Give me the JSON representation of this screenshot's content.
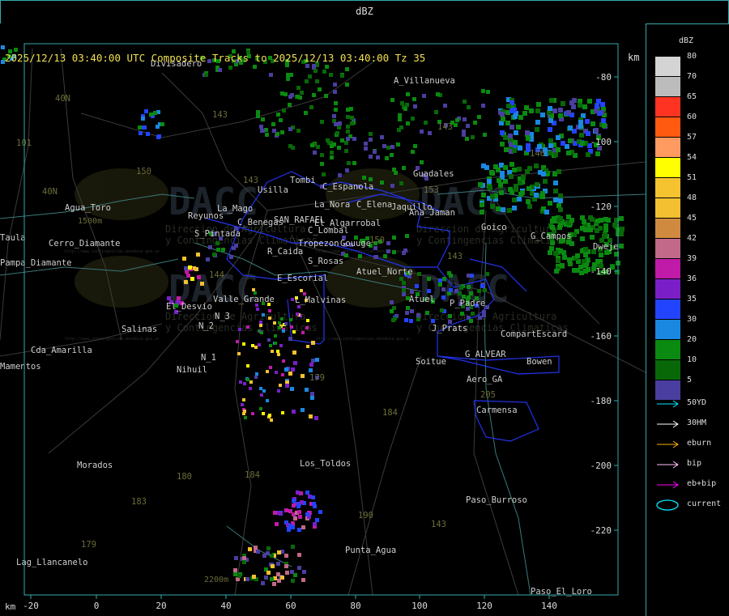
{
  "window": {
    "title": "dBZ"
  },
  "header": {
    "text": "2025/12/13 03:40:00 UTC Composite Tracks to 2025/12/13 03:40:00 Tz 35",
    "km_label": "km"
  },
  "axes": {
    "x_label": "km",
    "x_ticks": [
      "-20",
      "0",
      "20",
      "40",
      "60",
      "80",
      "100",
      "120",
      "140"
    ],
    "y_ticks": [
      "-80",
      "-100",
      "-120",
      "-140",
      "-160",
      "-180",
      "-200",
      "-220"
    ]
  },
  "legend": {
    "title": "dBZ",
    "bins": [
      {
        "label": "80",
        "color": "#d4d4d4"
      },
      {
        "label": "70",
        "color": "#bcbcbc"
      },
      {
        "label": "65",
        "color": "#ff3322"
      },
      {
        "label": "60",
        "color": "#ff5a10"
      },
      {
        "label": "57",
        "color": "#ff9a60"
      },
      {
        "label": "54",
        "color": "#ffff00"
      },
      {
        "label": "51",
        "color": "#f5c230"
      },
      {
        "label": "48",
        "color": "#f2c030"
      },
      {
        "label": "45",
        "color": "#d08a40"
      },
      {
        "label": "42",
        "color": "#c26888"
      },
      {
        "label": "39",
        "color": "#c01aa8"
      },
      {
        "label": "36",
        "color": "#7a1fc8"
      },
      {
        "label": "35",
        "color": "#2244ff"
      },
      {
        "label": "30",
        "color": "#1a88e0"
      },
      {
        "label": "20",
        "color": "#0a8a10"
      },
      {
        "label": "10",
        "color": "#086808"
      },
      {
        "label": "5",
        "color": "#4a3ea0"
      }
    ],
    "tracks": [
      {
        "label": "50YD",
        "color": "#00e8ff"
      },
      {
        "label": "30HM",
        "color": "#ffffff"
      },
      {
        "label": "eburn",
        "color": "#ffb000"
      },
      {
        "label": "bip",
        "color": "#ffc0ff"
      },
      {
        "label": "eb+bip",
        "color": "#ff00ff"
      }
    ],
    "current": {
      "label": "current",
      "color": "#00e8ff"
    }
  },
  "places": [
    {
      "name": "Divisadero"
    },
    {
      "name": "A_Villanueva"
    },
    {
      "name": "Guadales"
    },
    {
      "name": "Usilla"
    },
    {
      "name": "Tombi"
    },
    {
      "name": "C_Espanola"
    },
    {
      "name": "La_Nora"
    },
    {
      "name": "C_Elena"
    },
    {
      "name": "Jaquillo"
    },
    {
      "name": "Ana_Jaman"
    },
    {
      "name": "Goico"
    },
    {
      "name": "G_Campos"
    },
    {
      "name": "Dweje"
    },
    {
      "name": "Agua_Toro"
    },
    {
      "name": "Bowen"
    },
    {
      "name": "Reyunos"
    },
    {
      "name": "La_Mago"
    },
    {
      "name": "C_Benegas"
    },
    {
      "name": "SAN_RAFAEL"
    },
    {
      "name": "El_Algarrobal"
    },
    {
      "name": "C_Lombal"
    },
    {
      "name": "S_Pintada"
    },
    {
      "name": "Pampa_Diamante"
    },
    {
      "name": "Cerro_Diamante"
    },
    {
      "name": "Taula"
    },
    {
      "name": "R_Caida"
    },
    {
      "name": "Tropezon"
    },
    {
      "name": "Gouuge"
    },
    {
      "name": "S_Rosas"
    },
    {
      "name": "Atuel_Norte"
    },
    {
      "name": "E_Escorial"
    },
    {
      "name": "El_Desvio"
    },
    {
      "name": "Valle_Grande"
    },
    {
      "name": "L_Malvinas"
    },
    {
      "name": "Atuel"
    },
    {
      "name": "P_Padre"
    },
    {
      "name": "Salinas"
    },
    {
      "name": "N_3"
    },
    {
      "name": "N_2"
    },
    {
      "name": "N_1"
    },
    {
      "name": "J_Prats"
    },
    {
      "name": "CompartEscard"
    },
    {
      "name": "Cda_Amarilla"
    },
    {
      "name": "Mamentos"
    },
    {
      "name": "Nihuil"
    },
    {
      "name": "G_ALVEAR"
    },
    {
      "name": "Soitue"
    },
    {
      "name": "Aero_GA"
    },
    {
      "name": "Carmensa"
    },
    {
      "name": "Morados"
    },
    {
      "name": "Los_Toldos"
    },
    {
      "name": "Paso_Burroso"
    },
    {
      "name": "Punta_Agua"
    },
    {
      "name": "Lag_Llancanelo"
    },
    {
      "name": "Paso_El_Loro"
    }
  ],
  "route_labels": [
    "40N",
    "40N",
    "101",
    "143",
    "143",
    "150",
    "150",
    "153",
    "143",
    "146",
    "144",
    "143",
    "179",
    "184",
    "180",
    "184",
    "183",
    "179",
    "190",
    "143",
    "205"
  ],
  "elevations": [
    "1500m",
    "2200m"
  ],
  "watermark": {
    "text": "DACC",
    "line1": "Direccion de Agricultura",
    "line2": "y Contingencias Climaticas",
    "url": "http://www.contingencias.mendoza.gov.ar"
  }
}
